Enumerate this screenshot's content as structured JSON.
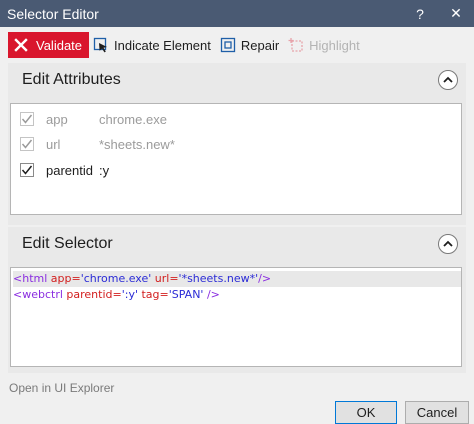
{
  "window": {
    "title": "Selector Editor",
    "help_glyph": "?",
    "close_glyph": "✕"
  },
  "toolbar": {
    "validate_label": "Validate",
    "indicate_label": "Indicate Element",
    "repair_label": "Repair",
    "highlight_label": "Highlight",
    "validate_color": "#d9162d"
  },
  "attributes_section": {
    "title": "Edit Attributes",
    "rows": [
      {
        "name": "app",
        "value": "chrome.exe",
        "checked": true,
        "enabled": false
      },
      {
        "name": "url",
        "value": "*sheets.new*",
        "checked": true,
        "enabled": false
      },
      {
        "name": "parentid",
        "value": ":y",
        "checked": true,
        "enabled": true
      }
    ]
  },
  "selector_section": {
    "title": "Edit Selector",
    "lines": [
      {
        "open": "<html",
        "a1": " app=",
        "v1": "'chrome.exe'",
        "a2": " url=",
        "v2": "'*sheets.new*'",
        "close": "/>"
      },
      {
        "open": "<webctrl",
        "a1": " parentid=",
        "v1": "':y'",
        "a2": " tag=",
        "v2": "'SPAN'",
        "close": " />"
      }
    ]
  },
  "footer": {
    "explorer_link": "Open in UI Explorer",
    "ok_label": "OK",
    "cancel_label": "Cancel"
  }
}
